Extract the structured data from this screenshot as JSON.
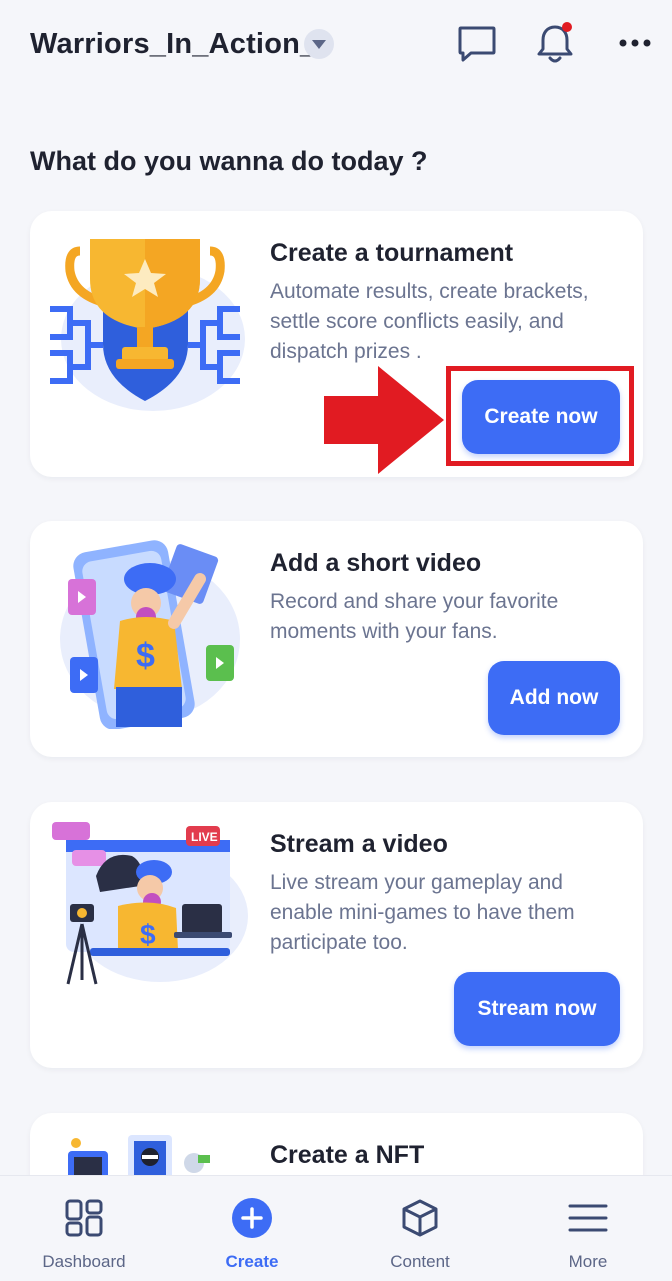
{
  "header": {
    "username": "Warriors_In_Action_",
    "icons": [
      "chevron-down-icon",
      "chat-icon",
      "bell-icon",
      "more-icon"
    ],
    "notification_dot_color": "#e11b22"
  },
  "prompt": "What do you wanna do today ?",
  "cards": [
    {
      "title": "Create a tournament",
      "description": "Automate results, create brackets, settle score conflicts easily, and dispatch prizes .",
      "button": "Create now",
      "illustration": "trophy-illustration"
    },
    {
      "title": "Add a short video",
      "description": "Record and share your favorite moments with your fans.",
      "button": "Add now",
      "illustration": "selfie-illustration"
    },
    {
      "title": "Stream a video",
      "description": "Live stream your gameplay and enable mini-games to have them participate too.",
      "button": "Stream now",
      "illustration": "stream-illustration"
    },
    {
      "title": "Create a NFT",
      "illustration": "nft-illustration"
    }
  ],
  "stream_badge": "LIVE",
  "nav": [
    {
      "label": "Dashboard",
      "icon": "dashboard-icon"
    },
    {
      "label": "Create",
      "icon": "plus-circle-icon",
      "active": true
    },
    {
      "label": "Content",
      "icon": "box-icon"
    },
    {
      "label": "More",
      "icon": "menu-icon"
    }
  ],
  "colors": {
    "accent": "#3d6cf5",
    "annotation": "#e11b22",
    "background": "#f5f6fa"
  }
}
